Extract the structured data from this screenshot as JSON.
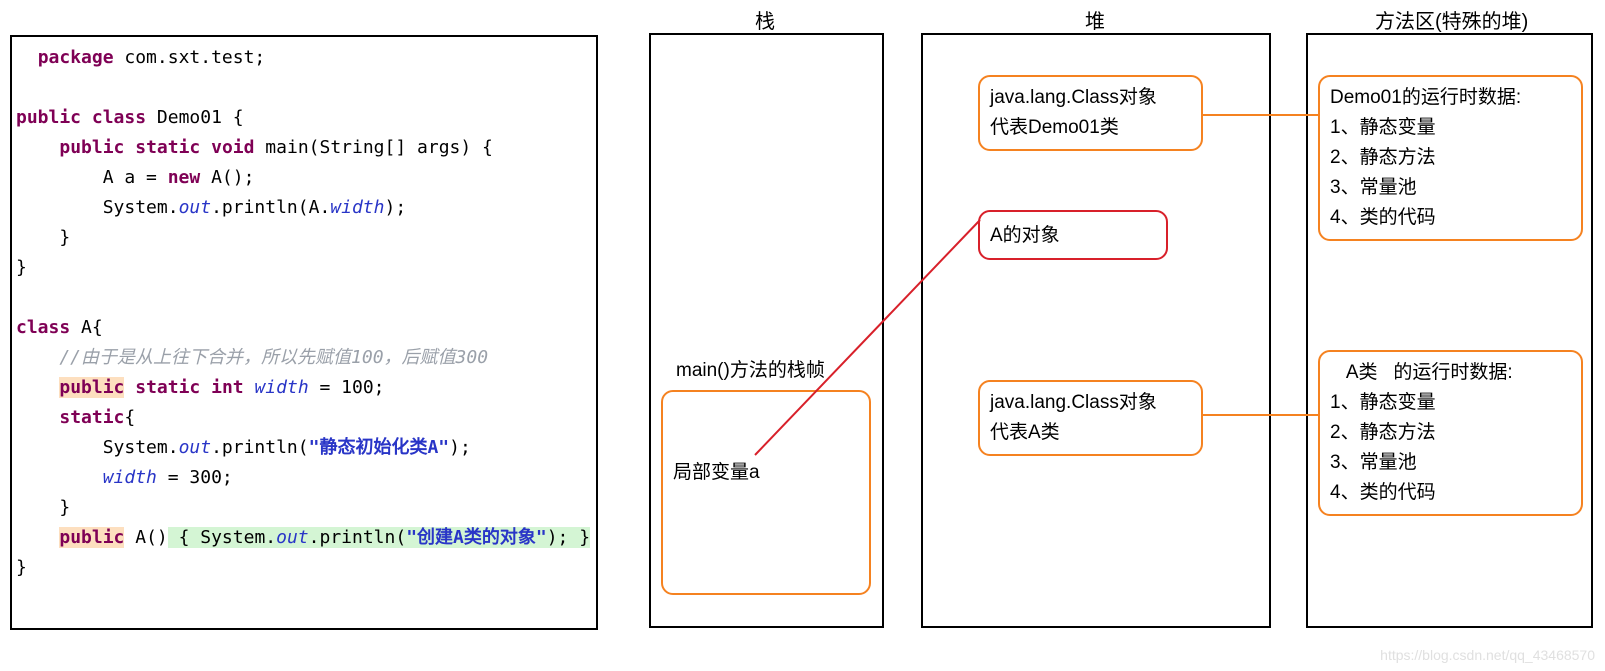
{
  "headers": {
    "stack": "栈",
    "heap": "堆",
    "method": "方法区(特殊的堆)"
  },
  "stack": {
    "frame_label": "main()方法的栈帧",
    "local_var": "局部变量a"
  },
  "heap": {
    "class_demo_l1": "java.lang.Class对象",
    "class_demo_l2": "代表Demo01类",
    "a_obj": "A的对象",
    "class_a_l1": "java.lang.Class对象",
    "class_a_l2": "代表A类"
  },
  "method_area": {
    "demo_title": "Demo01的运行时数据:",
    "r1": "1、静态变量",
    "r2": "2、静态方法",
    "r3": "3、常量池",
    "r4": "4、类的代码",
    "a_title_prefix": "A类",
    "a_title_suffix": "的运行时数据:"
  },
  "code": {
    "package": "package",
    "pkg_name": " com.sxt.test;",
    "public": "public",
    "class": "class",
    "static": "static",
    "void": "void",
    "int": "int",
    "new": "new",
    "demo": " Demo01 {",
    "main_sig": " main(String[] args) {",
    "a_decl": "        A a = ",
    "a_ctor": " A();",
    "sysout1": "        System.",
    "out": "out",
    "println1": ".println(A.",
    "width": "width",
    "endp": ");",
    "closeb": "    }",
    "closeb2": "}",
    "classA": " A{",
    "comment": "    //由于是从上往下合并，所以先赋值100，后赋值300",
    "width_decl": " = 100;",
    "static_blk": "{",
    "println2": ".println(",
    "str1": "\"静态初始化类A\"",
    "endp2": ");",
    "width_assign": " = 300;",
    "ctor_sig": " A()",
    "ctor_body1": " { System.",
    "println3": ".println(",
    "str2": "\"创建A类的对象\"",
    "ctor_end": "); }"
  },
  "watermark": "https://blog.csdn.net/qq_43468570"
}
